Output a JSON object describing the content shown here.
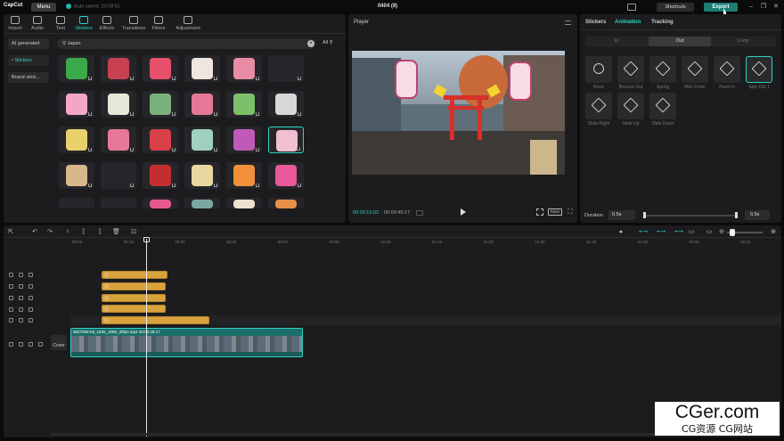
{
  "app": {
    "logo": "CapCut",
    "menu": "Menu",
    "autosave": "Auto saved: 23:08:51",
    "project": "0404 (8)",
    "shortcuts": "Shortcuts",
    "export": "Export"
  },
  "tabs": [
    {
      "label": "Import"
    },
    {
      "label": "Audio"
    },
    {
      "label": "Text"
    },
    {
      "label": "Stickers"
    },
    {
      "label": "Effects"
    },
    {
      "label": "Transitions"
    },
    {
      "label": "Filters"
    },
    {
      "label": "Adjustment"
    }
  ],
  "categories": [
    {
      "label": "AI generated"
    },
    {
      "label": "• Stickers"
    },
    {
      "label": "Brand stick..."
    }
  ],
  "search": {
    "query": "Japan",
    "filter": "All"
  },
  "stickers": [
    {
      "icon": "japan-map-sticker",
      "color": "#3aa94a"
    },
    {
      "icon": "mount-fuji-sticker",
      "color": "#c94050"
    },
    {
      "icon": "torii-frame-sticker",
      "color": "#e6506a"
    },
    {
      "icon": "snowman-sticker",
      "color": "#f0e6e0"
    },
    {
      "icon": "torii-gate-sticker",
      "color": "#e88ca6"
    },
    {
      "icon": "blank-sticker",
      "color": "#26262a"
    },
    {
      "icon": "sakura-sticker",
      "color": "#f4a6c6"
    },
    {
      "icon": "sushi-roll-sticker",
      "color": "#e8e8d8"
    },
    {
      "icon": "sushi-plate-sticker",
      "color": "#7ab07c"
    },
    {
      "icon": "carp-streamer-sticker",
      "color": "#e57896"
    },
    {
      "icon": "pagoda-sticker",
      "color": "#7cc06a"
    },
    {
      "icon": "sparkles-sticker",
      "color": "#d8d8d8"
    },
    {
      "icon": "dango-sticker",
      "color": "#e8d06a"
    },
    {
      "icon": "fan-sticker",
      "color": "#e87898"
    },
    {
      "icon": "japan-flag-sticker",
      "color": "#d8404a"
    },
    {
      "icon": "fuji-circle-sticker",
      "color": "#9fd0c0"
    },
    {
      "icon": "sparkle-gem-sticker",
      "color": "#c05ab8"
    },
    {
      "icon": "lantern-sticker",
      "color": "#f0c0d0"
    },
    {
      "icon": "stamp-sticker",
      "color": "#d8b88a"
    },
    {
      "icon": "blank-sticker",
      "color": "#26262a"
    },
    {
      "icon": "umbrella-sticker",
      "color": "#c42e2e"
    },
    {
      "icon": "sushi-set-sticker",
      "color": "#e8d8a0"
    },
    {
      "icon": "salmon-roll-sticker",
      "color": "#f09038"
    },
    {
      "icon": "blossom-sticker",
      "color": "#e8589a"
    },
    {
      "icon": "partial-sticker",
      "color": "#26262a"
    },
    {
      "icon": "partial-sticker",
      "color": "#26262a"
    },
    {
      "icon": "flower-sticker",
      "color": "#e85890"
    },
    {
      "icon": "temple-sticker",
      "color": "#7aa8a0"
    },
    {
      "icon": "mountain-sticker",
      "color": "#f0e0d0"
    },
    {
      "icon": "bowl-sticker",
      "color": "#e89048"
    }
  ],
  "player": {
    "title": "Player",
    "current": "00:00:15:02",
    "total": "00:00:45:17",
    "ratio": "Ratio"
  },
  "right": {
    "tabs": [
      "Stickers",
      "Animation",
      "Tracking"
    ],
    "segments": [
      "In",
      "Out",
      "Loop"
    ],
    "animations": [
      {
        "label": "None"
      },
      {
        "label": "Bounce Out"
      },
      {
        "label": "Spring"
      },
      {
        "label": "Mini Zoom"
      },
      {
        "label": "Zoom In"
      },
      {
        "label": "Spin Out 1"
      },
      {
        "label": "Slide Right"
      },
      {
        "label": "Slide Up"
      },
      {
        "label": "Slide Down"
      }
    ],
    "duration_label": "Duration",
    "duration_min": "0.5s",
    "duration_value": "0.5s"
  },
  "ruler": [
    "00:00",
    "00:10",
    "00:20",
    "00:30",
    "00:40",
    "00:50",
    "01:00",
    "01:10",
    "01:20",
    "01:30",
    "01:40",
    "01:50",
    "02:00",
    "02:10"
  ],
  "video_clip": {
    "name": "5827569-hd_1920_1080_30fps.mp4",
    "duration": "00:00:45:17",
    "cover": "Cover"
  },
  "watermark": {
    "main": "CGer.com",
    "sub": "CG资源 CG网站"
  }
}
